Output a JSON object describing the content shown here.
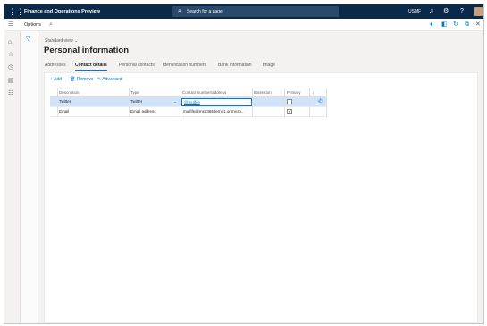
{
  "topbar": {
    "waffle_icon": "waffle-icon",
    "app_title": "Finance and Operations Preview",
    "search_placeholder": "Search for a page",
    "company": "USMF",
    "icons": [
      "bell-icon",
      "gear-icon",
      "help-icon",
      "avatar"
    ]
  },
  "options_row": {
    "label": "Options",
    "icons": [
      "search-icon",
      "favorite-icon",
      "office-icon",
      "refresh-icon",
      "popout-icon",
      "close-icon"
    ]
  },
  "left_nav": {
    "icons": [
      "hamburger-icon",
      "home-icon",
      "star-icon",
      "clock-icon",
      "workspace-icon",
      "list-icon"
    ]
  },
  "page": {
    "view_name": "Standard view",
    "title": "Personal information"
  },
  "tabs": [
    {
      "label": "Addresses",
      "active": false
    },
    {
      "label": "Contact details",
      "active": true
    },
    {
      "label": "Personal contacts",
      "active": false
    },
    {
      "label": "Identification numbers",
      "active": false
    },
    {
      "label": "Bank information",
      "active": false
    },
    {
      "label": "Image",
      "active": false
    }
  ],
  "actions": {
    "add": "+ Add",
    "remove": "Remove",
    "advanced": "Advanced"
  },
  "grid": {
    "columns": [
      "Description",
      "Type",
      "Contact number/address",
      "Extension",
      "Primary",
      "↓"
    ],
    "rows": [
      {
        "description": "Twitter",
        "type": "Twitter",
        "contact": "@mulfife",
        "extension": "",
        "primary": false
      },
      {
        "description": "Email",
        "type": "Email address",
        "contact": "mulfife@msd365demo1.onmicro...",
        "extension": "",
        "primary": true
      }
    ]
  },
  "colors": {
    "topbar": "#0b2a4a",
    "accent": "#0078d4",
    "selected_row": "#cfe4fa"
  }
}
